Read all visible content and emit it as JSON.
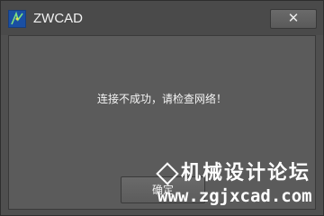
{
  "window": {
    "title": "ZWCAD",
    "close_glyph": "✕",
    "app_icon": "zwcad-app-icon"
  },
  "dialog": {
    "message": "连接不成功，请检查网络！",
    "ok_label": "确定"
  },
  "watermark": {
    "line1": "机械设计论坛",
    "line2": "www.zgjxcad.com"
  },
  "colors": {
    "background": "#4f4f4f",
    "panel": "#5b5b5b",
    "text": "#f5f5f5"
  }
}
